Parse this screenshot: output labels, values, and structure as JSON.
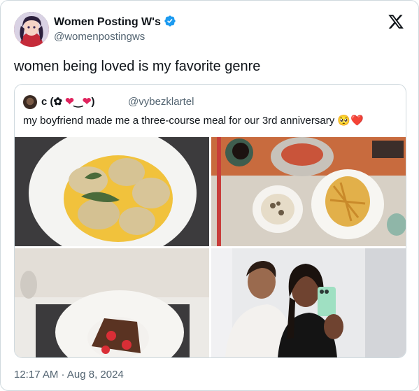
{
  "author": {
    "name": "Women Posting W's",
    "handle": "@womenpostingws",
    "verified": true
  },
  "tweet": {
    "text": "women being loved is my favorite genre",
    "timestamp": "12:17 AM · Aug 8, 2024"
  },
  "quoted": {
    "name_prefix": "c (✿ ",
    "name_heart1": "❤",
    "name_mid": "‿",
    "name_heart2": "❤",
    "name_suffix": ")",
    "handle": "@vybezklartel",
    "text": "my boyfriend made me a three-course meal for our 3rd anniversary ",
    "emojis": "🥺❤️"
  },
  "media": [
    {
      "name": "ravioli-photo"
    },
    {
      "name": "table-meal-photo"
    },
    {
      "name": "dessert-photo"
    },
    {
      "name": "couple-selfie-photo"
    }
  ],
  "icons": {
    "logo": "x-logo-icon",
    "verified": "verified-badge-icon"
  },
  "colors": {
    "verified": "#1d9bf0",
    "heart": "#e0245e",
    "secondary_text": "#536471",
    "border": "#cfd9de"
  }
}
